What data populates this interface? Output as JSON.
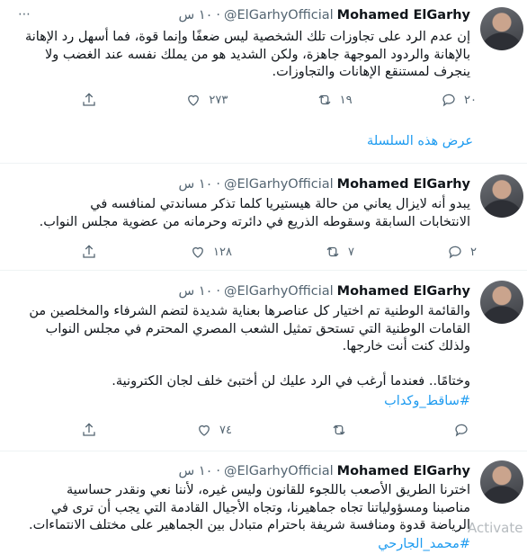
{
  "tweets": [
    {
      "name": "Mohamed ElGarhy",
      "handle": "@ElGarhyOfficial",
      "time": "١٠ س",
      "text": "إن عدم الرد على تجاوزات تلك الشخصية ليس ضعفًا وإنما قوة، فما أسهل رد الإهانة\nبالإهانة والردود الموجهة جاهزة، ولكن الشديد هو من يملك نفسه عند الغضب ولا\nينجرف لمستنقع الإهانات والتجاوزات.",
      "replies": "٢٠",
      "retweets": "١٩",
      "likes": "٢٧٣",
      "show_thread": "عرض هذه السلسلة"
    },
    {
      "name": "Mohamed ElGarhy",
      "handle": "@ElGarhyOfficial",
      "time": "١٠ س",
      "text": "يبدو أنه لايزال يعاني من حالة هيستيريا كلما تذكر مساندتي لمنافسه في\nالانتخابات السابقة وسقوطه الذريع في دائرته وحرمانه من عضوية مجلس النواب.",
      "replies": "٢",
      "retweets": "٧",
      "likes": "١٢٨"
    },
    {
      "name": "Mohamed ElGarhy",
      "handle": "@ElGarhyOfficial",
      "time": "١٠ س",
      "text": "والقائمة الوطنية تم اختيار كل عناصرها بعناية شديدة لتضم الشرفاء والمخلصين من\nالقامات الوطنية التي تستحق تمثيل الشعب المصري المحترم في مجلس النواب\nولذلك كنت أنت خارجها.\n\nوختامًا.. فعندما أرغب في الرد عليك لن أختبئ خلف لجان الكترونية.",
      "hashtag": "#ساقط_وكداب",
      "replies": "",
      "retweets": "",
      "likes": "٧٤"
    },
    {
      "name": "Mohamed ElGarhy",
      "handle": "@ElGarhyOfficial",
      "time": "١٠ س",
      "text": "اخترنا الطريق الأصعب باللجوء للقانون وليس غيره، لأننا نعي ونقدر حساسية\nمناصبنا ومسؤولياتنا تجاه جماهيرنا، وتجاه الأجيال القادمة التي يجب أن ترى في\nالرياضة قدوة ومنافسة شريفة باحترام متبادل بين الجماهير على مختلف الانتماءات.",
      "hashtag": "#محمد_الجارحي"
    }
  ],
  "more_icon": "⋯",
  "watermark": "Activate"
}
